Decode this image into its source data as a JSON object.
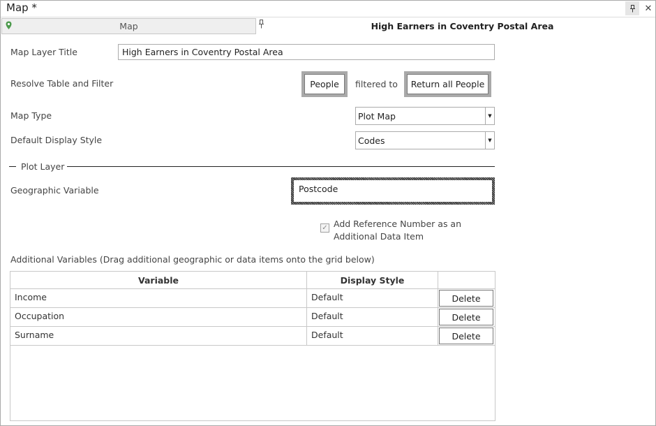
{
  "window": {
    "title": "Map *"
  },
  "tab": {
    "label": "Map",
    "icon": "map-marker-icon"
  },
  "header_title": "High Earners in Coventry Postal Area",
  "form": {
    "map_layer_title_label": "Map Layer Title",
    "map_layer_title_value": "High Earners in Coventry Postal Area",
    "resolve_label": "Resolve Table and Filter",
    "resolve_table": "People",
    "filtered_to_label": "filtered to",
    "resolve_filter": "Return all People",
    "map_type_label": "Map Type",
    "map_type_value": "Plot Map",
    "display_style_label": "Default Display Style",
    "display_style_value": "Codes",
    "plot_layer_label": "Plot Layer",
    "geo_var_label": "Geographic Variable",
    "geo_var_value": "Postcode",
    "add_ref_line1": "Add Reference Number as an",
    "add_ref_line2": "Additional Data Item",
    "add_ref_checked": true,
    "additional_vars_label": "Additional Variables (Drag additional geographic or data items onto the grid below)"
  },
  "grid": {
    "columns": [
      "Variable",
      "Display Style",
      ""
    ],
    "rows": [
      {
        "variable": "Income",
        "style": "Default",
        "action": "Delete"
      },
      {
        "variable": "Occupation",
        "style": "Default",
        "action": "Delete"
      },
      {
        "variable": "Surname",
        "style": "Default",
        "action": "Delete"
      }
    ]
  },
  "colors": {
    "accent_pin": "#4c9a4c",
    "frame": "#a9a9a9"
  }
}
